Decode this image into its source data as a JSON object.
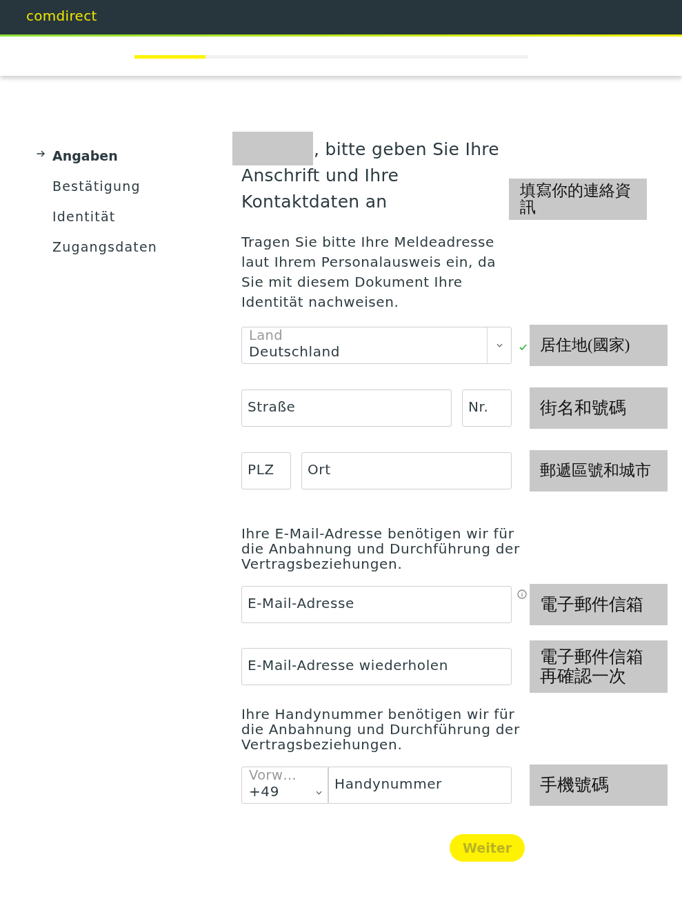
{
  "header": {
    "logo": "comdirect"
  },
  "progress": {
    "level": 0.18
  },
  "steps": [
    {
      "label": "Angaben",
      "selected": true
    },
    {
      "label": "Bestätigung",
      "selected": false
    },
    {
      "label": "Identität",
      "selected": false
    },
    {
      "label": "Zugangsdaten",
      "selected": false
    }
  ],
  "heading": {
    "redacted": true,
    "text": ", bitte geben Sie Ihre Anschrift und Ihre Kontaktdaten an",
    "annotation": "填寫你的連絡資訊"
  },
  "address": {
    "intro": "Tragen Sie bitte Ihre Meldeadresse laut Ihrem Personalausweis ein, da Sie mit diesem Dokument Ihre Identität nachweisen.",
    "rows": [
      {
        "kind": "validated",
        "fields": [
          {
            "kind": "select",
            "label": "Land",
            "value": "Deutschland"
          }
        ],
        "annotation": "居住地(國家)"
      },
      {
        "kind": "plain",
        "fields": [
          {
            "kind": "input",
            "placeholder": "Straße"
          },
          {
            "kind": "short_input",
            "placeholder": "Nr."
          }
        ],
        "annotation": "街名和號碼"
      },
      {
        "kind": "plain",
        "fields": [
          {
            "kind": "short_input",
            "placeholder": "PLZ"
          },
          {
            "kind": "input",
            "placeholder": "Ort"
          }
        ],
        "annotation": "郵遞區號和城市"
      }
    ]
  },
  "contact": [
    {
      "note": "Ihre E-Mail-Adresse benötigen wir für die Anbahnung und Durchführung der Vertragsbeziehungen.",
      "rows": [
        {
          "kind": "help",
          "fields": [
            {
              "kind": "input",
              "placeholder": "E-Mail-Adresse"
            }
          ],
          "annotation": "電子郵件信箱"
        },
        {
          "kind": "plain",
          "fields": [
            {
              "kind": "input",
              "placeholder": "E-Mail-Adresse wiederholen"
            }
          ],
          "annotation": "電子郵件信箱再確認一次"
        }
      ]
    },
    {
      "note": "Ihre Handynummer benötigen wir für die Anbahnung und Durchführung der Vertragsbeziehungen.",
      "rows": [
        {
          "kind": "plain",
          "fields": [
            {
              "kind": "prefix_select",
              "label": "Vorw…",
              "value": "+49"
            },
            {
              "kind": "input",
              "placeholder": "Handynummer"
            }
          ],
          "annotation": "手機號碼"
        }
      ]
    }
  ],
  "button": {
    "label": "Weiter",
    "disabled": true
  }
}
